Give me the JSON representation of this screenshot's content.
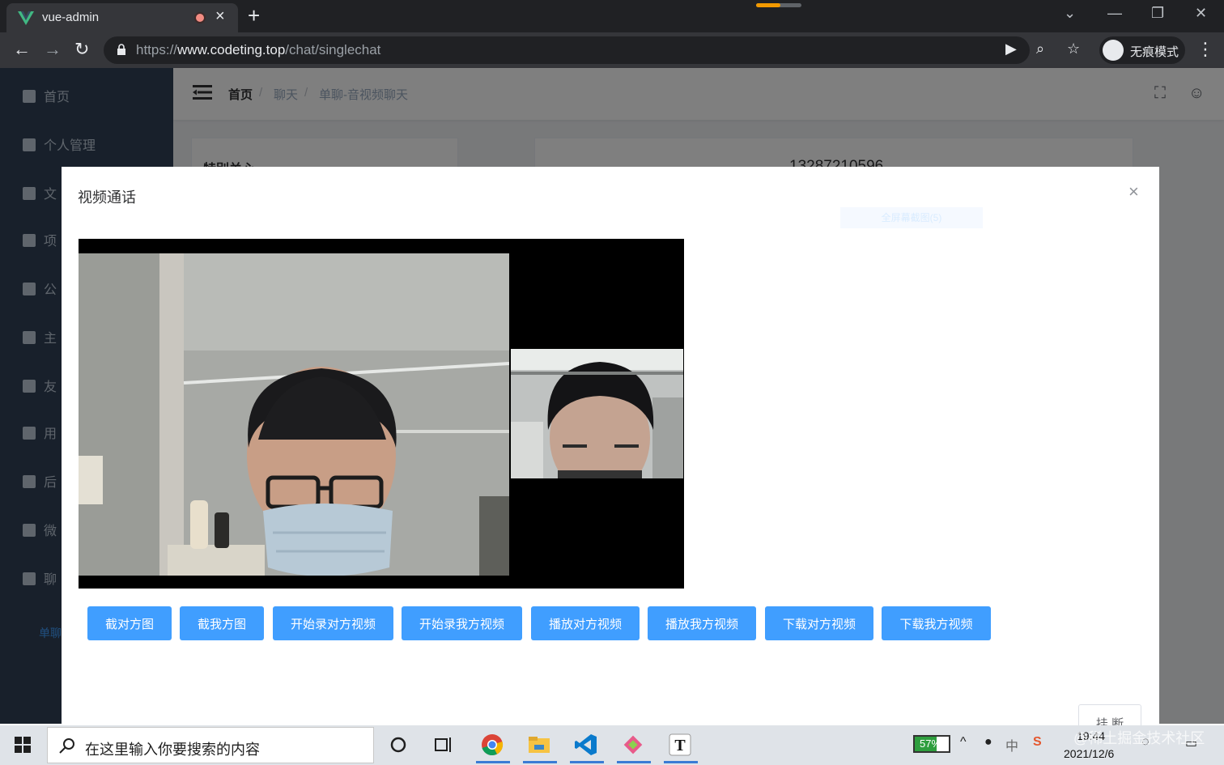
{
  "browser": {
    "tab_title": "vue-admin",
    "tab_close": "×",
    "new_tab": "+",
    "url_prefix": "https://",
    "url_host": "www.codeting.top",
    "url_path": "/chat/singlechat",
    "incognito_label": "无痕模式"
  },
  "sidebar": {
    "items": [
      {
        "label": "首页",
        "icon": "dashboard-icon"
      },
      {
        "label": "个人管理",
        "icon": "user-icon"
      },
      {
        "label": "文",
        "icon": "chart-icon"
      },
      {
        "label": "项",
        "icon": "monitor-icon"
      },
      {
        "label": "公",
        "icon": "location-icon"
      },
      {
        "label": "主",
        "icon": "flag-icon"
      },
      {
        "label": "友",
        "icon": "link-icon"
      },
      {
        "label": "用",
        "icon": "flag-icon"
      },
      {
        "label": "后",
        "icon": "camera-icon"
      },
      {
        "label": "微",
        "icon": "book-icon"
      },
      {
        "label": "聊",
        "icon": "video-icon"
      }
    ],
    "active_sub": "单聊"
  },
  "navbar": {
    "breadcrumb": [
      "首页",
      "聊天",
      "单聊-音视频聊天"
    ],
    "sep": "/"
  },
  "background": {
    "select_label": "特别关心",
    "contact_number": "13287210596"
  },
  "dialog": {
    "title": "视频通话",
    "close": "×",
    "faint_tag": "全屏幕截图(5)",
    "buttons": [
      "截对方图",
      "截我方图",
      "开始录对方视频",
      "开始录我方视频",
      "播放对方视频",
      "播放我方视频",
      "下载对方视频",
      "下载我方视频"
    ],
    "hangup": "挂 断"
  },
  "taskbar": {
    "search_placeholder": "在这里输入你要搜索的内容",
    "battery": "57%",
    "ime": "中",
    "time": "19:44",
    "date": "2021/12/6",
    "watermark": "@稀土掘金技术社区"
  },
  "colors": {
    "primary": "#409eff",
    "sidebar": "#304156",
    "chrome_dark": "#202124"
  }
}
